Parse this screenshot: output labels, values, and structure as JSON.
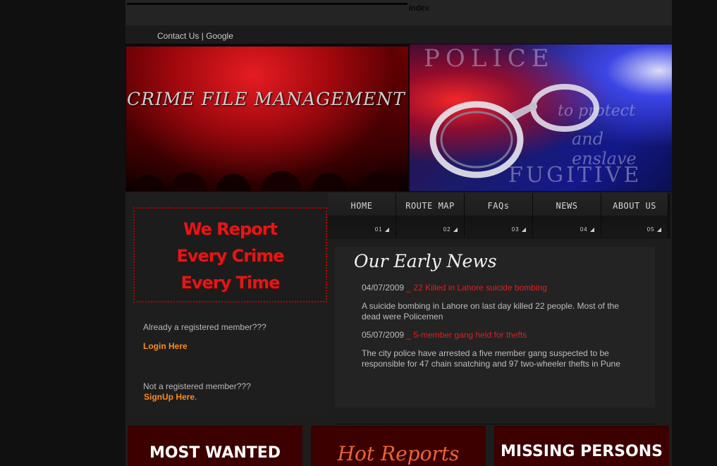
{
  "top": {
    "index_label": "index",
    "links": {
      "contact": "Contact Us",
      "separator": "|",
      "google": "Google"
    }
  },
  "banner": {
    "title": "CRIME FILE MANAGEMENT",
    "right_words": {
      "police": "POLICE",
      "protect": "to protect",
      "enslave": "and enslave",
      "fugitive": "FUGITIVE"
    }
  },
  "sidebar": {
    "stamp_lines": [
      "We Report",
      "Every Crime",
      "Every Time"
    ],
    "registered_prompt": "Already a registered member???",
    "login_label": "Login Here",
    "not_registered_prompt": "Not a registered member???",
    "signup_label": "SignUp Here",
    "signup_suffix": "."
  },
  "nav": [
    {
      "label": "HOME",
      "num": "01"
    },
    {
      "label": "ROUTE MAP",
      "num": "02"
    },
    {
      "label": "FAQs",
      "num": "03"
    },
    {
      "label": "NEWS",
      "num": "04"
    },
    {
      "label": "ABOUT US",
      "num": "05"
    }
  ],
  "news": {
    "title": "Our Early News",
    "items": [
      {
        "date": "04/07/2009",
        "headline": "_ 22 Killed in Lahore suicide bombing",
        "body": "A suicide bombing in Lahore on last day killed 22 people. Most of the dead were Policemen"
      },
      {
        "date": "05/07/2009",
        "headline": "_ 5-member gang held for thefts",
        "body": "The city police have arrested a five member gang suspected to be responsible for 47 chain snatching and 97 two-wheeler thefts in Pune"
      }
    ]
  },
  "boxes": {
    "most_wanted": "MOST WANTED",
    "hot_reports": "Hot Reports",
    "missing_persons": "MISSING PERSONS"
  },
  "colors": {
    "accent_orange": "#ff8a1f",
    "news_red": "#e01e1e",
    "box_red": "#3c0000"
  }
}
